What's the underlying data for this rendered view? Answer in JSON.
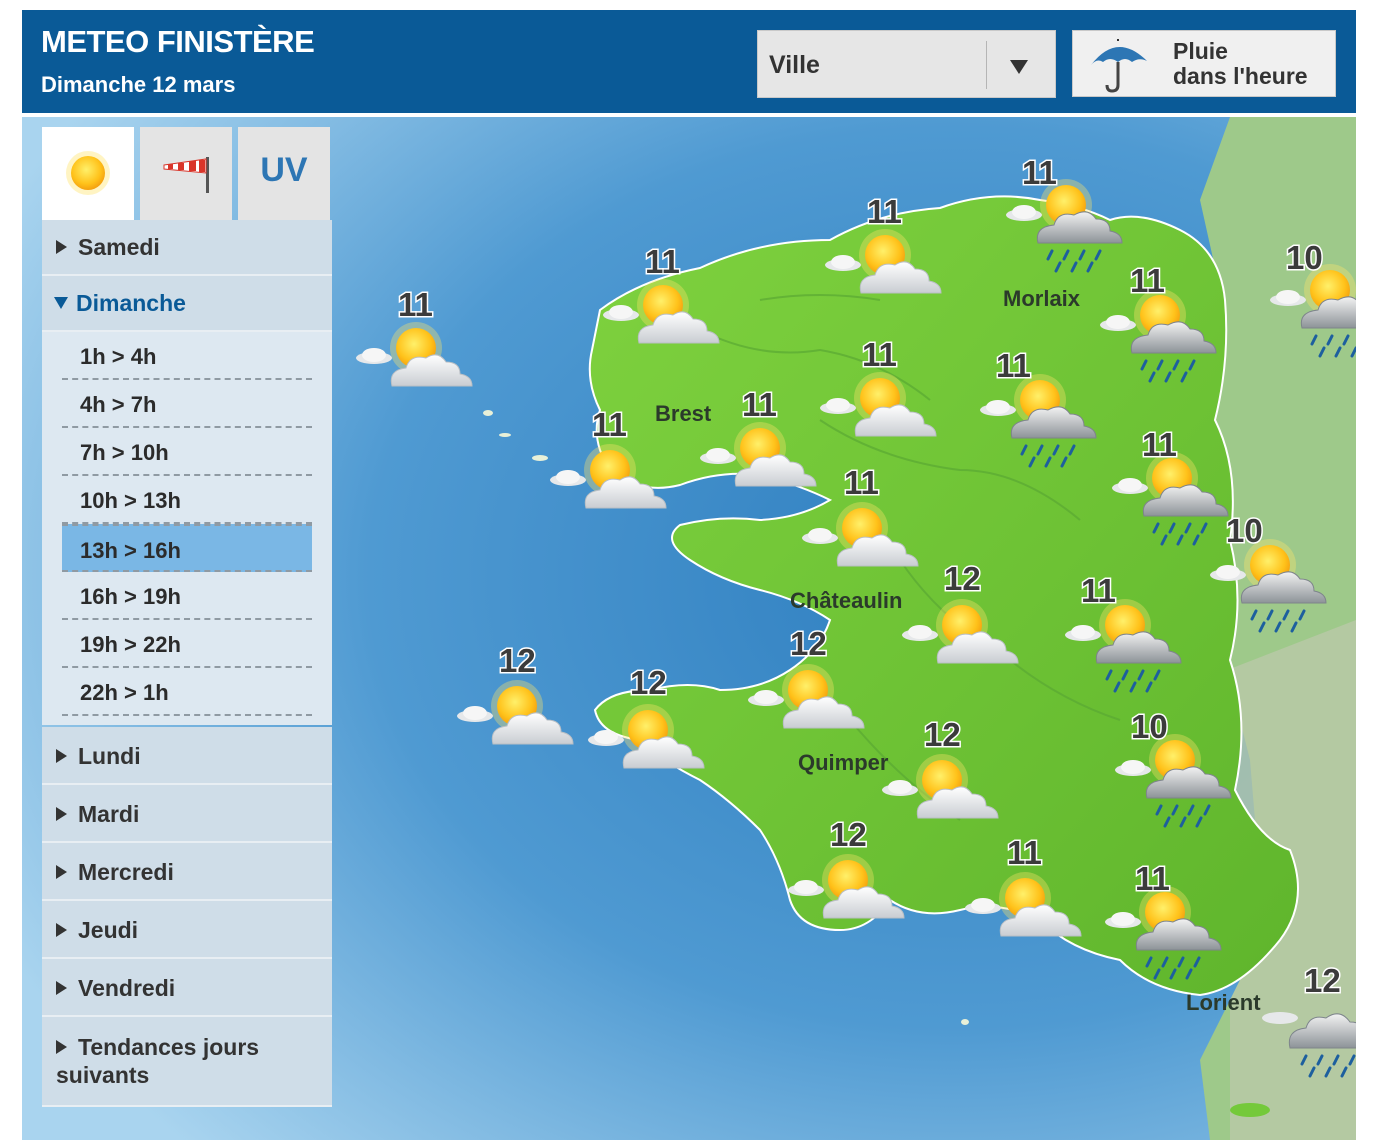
{
  "header": {
    "title": "METEO FINISTÈRE",
    "date": "Dimanche 12 mars",
    "city_select": "Ville",
    "rain_button": [
      "Pluie",
      "dans l'heure"
    ]
  },
  "tabs": {
    "sun_icon": "sun-icon",
    "wind_icon": "windsock-icon",
    "uv_label": "UV"
  },
  "days": {
    "samedi": "Samedi",
    "dimanche": "Dimanche",
    "lundi": "Lundi",
    "mardi": "Mardi",
    "mercredi": "Mercredi",
    "jeudi": "Jeudi",
    "vendredi": "Vendredi",
    "tendances": [
      "Tendances jours",
      "suivants"
    ]
  },
  "slots": [
    "1h > 4h",
    "4h > 7h",
    "7h > 10h",
    "10h > 13h",
    "13h > 16h",
    "16h > 19h",
    "19h > 22h",
    "22h > 1h"
  ],
  "selected_slot": "13h > 16h",
  "cities": [
    "Morlaix",
    "Brest",
    "Châteaulin",
    "Quimper",
    "Lorient"
  ],
  "forecasts": [
    {
      "temp": "11",
      "icon": "sun-cloud"
    },
    {
      "temp": "11",
      "icon": "sun-cloud"
    },
    {
      "temp": "11",
      "icon": "sun-cloud"
    },
    {
      "temp": "11",
      "icon": "sun-cloud-rain"
    },
    {
      "temp": "10",
      "icon": "sun-cloud-rain"
    },
    {
      "temp": "11",
      "icon": "sun-cloud-rain"
    },
    {
      "temp": "11",
      "icon": "sun-cloud"
    },
    {
      "temp": "11",
      "icon": "sun-cloud-rain"
    },
    {
      "temp": "11",
      "icon": "sun-cloud"
    },
    {
      "temp": "11",
      "icon": "sun-cloud"
    },
    {
      "temp": "11",
      "icon": "sun-cloud-rain"
    },
    {
      "temp": "11",
      "icon": "sun-cloud"
    },
    {
      "temp": "10",
      "icon": "sun-cloud-rain"
    },
    {
      "temp": "12",
      "icon": "sun-cloud"
    },
    {
      "temp": "11",
      "icon": "sun-cloud-rain"
    },
    {
      "temp": "12",
      "icon": "sun-cloud"
    },
    {
      "temp": "12",
      "icon": "sun-cloud"
    },
    {
      "temp": "12",
      "icon": "sun-cloud"
    },
    {
      "temp": "12",
      "icon": "sun-cloud"
    },
    {
      "temp": "10",
      "icon": "sun-cloud-rain"
    },
    {
      "temp": "12",
      "icon": "sun-cloud"
    },
    {
      "temp": "11",
      "icon": "sun-cloud"
    },
    {
      "temp": "11",
      "icon": "sun-cloud-rain"
    },
    {
      "temp": "12",
      "icon": "cloud-rain"
    }
  ],
  "colors": {
    "header": "#0a5a97",
    "sea": "#6fb2dc",
    "land": "#74c93a",
    "sidebar": "#cfdde8",
    "selected": "#7ab7e5"
  }
}
